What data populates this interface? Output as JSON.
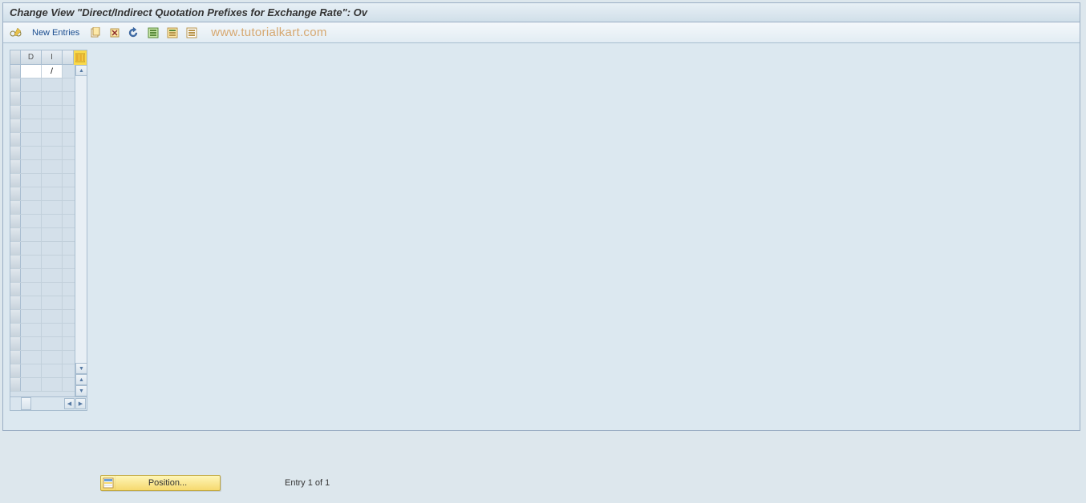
{
  "title": "Change View \"Direct/Indirect Quotation Prefixes for Exchange Rate\": Ov",
  "toolbar": {
    "new_entries_label": "New Entries",
    "icons": {
      "toggle": "toggle-display-change-icon",
      "copy": "copy-icon",
      "delete": "delete-icon",
      "undo": "undo-icon",
      "select_all": "select-all-icon",
      "select_block": "select-block-icon",
      "deselect": "deselect-icon"
    }
  },
  "watermark": "www.tutorialkart.com",
  "table": {
    "columns": [
      "D",
      "I"
    ],
    "rows": [
      {
        "d": "",
        "i": "/"
      }
    ],
    "empty_rows": 23
  },
  "footer": {
    "position_label": "Position...",
    "entry_status": "Entry 1 of 1"
  }
}
